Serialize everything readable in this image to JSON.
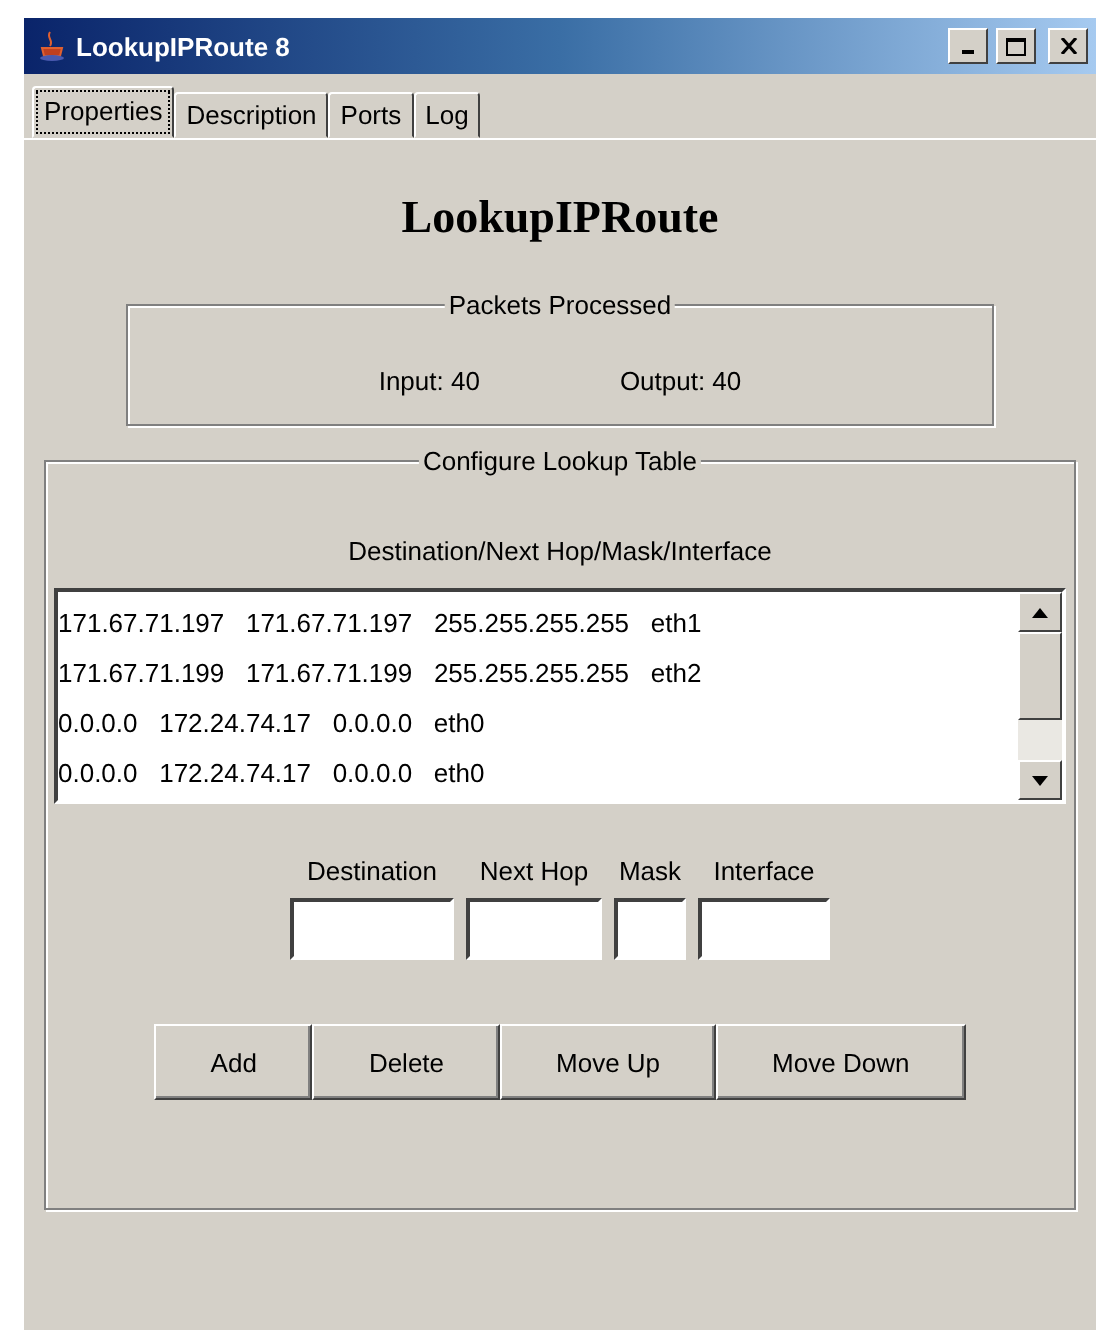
{
  "window": {
    "title": "LookupIPRoute 8"
  },
  "tabs": [
    {
      "label": "Properties",
      "selected": true
    },
    {
      "label": "Description",
      "selected": false
    },
    {
      "label": "Ports",
      "selected": false
    },
    {
      "label": "Log",
      "selected": false
    }
  ],
  "heading": "LookupIPRoute",
  "packets": {
    "title": "Packets Processed",
    "input": "Input: 40",
    "output": "Output: 40"
  },
  "lookup_table": {
    "title": "Configure Lookup Table",
    "list_caption": "Destination/Next Hop/Mask/Interface",
    "rows": [
      "171.67.71.197   171.67.71.197   255.255.255.255   eth1",
      "171.67.71.199   171.67.71.199   255.255.255.255   eth2",
      "0.0.0.0   172.24.74.17   0.0.0.0   eth0",
      "0.0.0.0   172.24.74.17   0.0.0.0   eth0"
    ],
    "fields": [
      {
        "label": "Destination"
      },
      {
        "label": "Next Hop"
      },
      {
        "label": "Mask"
      },
      {
        "label": "Interface"
      }
    ],
    "buttons": [
      "Add",
      "Delete",
      "Move Up",
      "Move Down"
    ]
  }
}
